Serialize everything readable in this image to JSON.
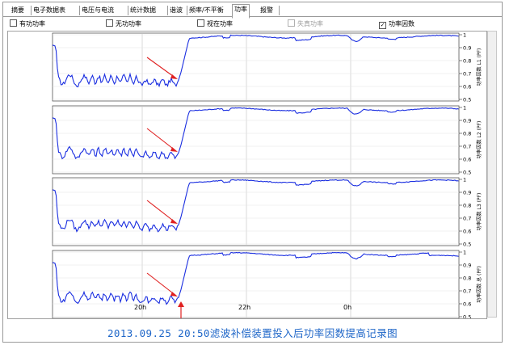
{
  "tabs": [
    "摘要",
    "电子数据表",
    "电压与电流",
    "统计数据",
    "谐波",
    "频率/不平衡",
    "功率",
    "报警"
  ],
  "active_tab": "功率",
  "options": [
    {
      "label": "有功功率",
      "checked": false,
      "enabled": true
    },
    {
      "label": "无功功率",
      "checked": false,
      "enabled": true
    },
    {
      "label": "视在功率",
      "checked": false,
      "enabled": true
    },
    {
      "label": "失真功率",
      "checked": false,
      "enabled": false
    },
    {
      "label": "功率因数",
      "checked": true,
      "enabled": true
    }
  ],
  "checkmark_symbol": "✓",
  "line_color": "#1a2ee0",
  "arrow_color": "#e02020",
  "panels": [
    {
      "axis_label": "功率因数 L1 (PF)"
    },
    {
      "axis_label": "功率因数 L2 (PF)"
    },
    {
      "axis_label": "功率因数 L3 (PF)"
    },
    {
      "axis_label": "功率因数 总 (PF)"
    }
  ],
  "y_ticks": [
    "1",
    "0.9",
    "0.8",
    "0.7",
    "0.6",
    "0.5"
  ],
  "x_ticks": [
    "20h",
    "22h",
    "0h"
  ],
  "caption": "2013.09.25 20:50滤波补偿装置投入后功率因数提高记录图"
}
